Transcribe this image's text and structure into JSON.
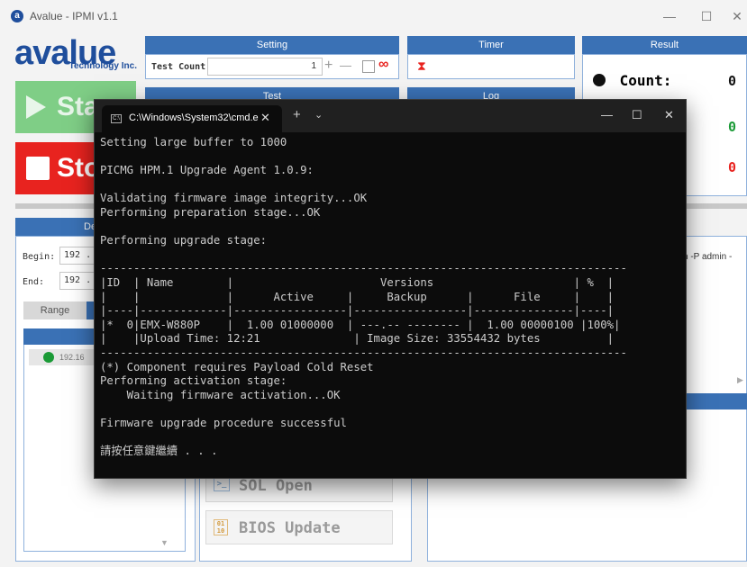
{
  "window": {
    "title": "Avalue - IPMI v1.1",
    "app_icon": "avalue-app-icon",
    "minimize": "—",
    "maximize": "☐",
    "close": "✕"
  },
  "logo": {
    "word": "avalue",
    "sub": "Technology Inc."
  },
  "buttons": {
    "start_label": "Sta",
    "stop_label": "Sto"
  },
  "setting": {
    "title": "Setting",
    "test_count_label": "Test Count",
    "test_count_value": "1",
    "plus": "+",
    "minus": "—",
    "infinity": "∞"
  },
  "timer": {
    "title": "Timer",
    "hourglass": "⧗"
  },
  "result": {
    "title": "Result",
    "count_label": "Count:",
    "count_value": "0",
    "row2_value": "0",
    "row3_value": "0"
  },
  "test": {
    "title": "Test"
  },
  "log": {
    "title": "Log"
  },
  "left": {
    "tab_de": "De",
    "begin_label": "Begin:",
    "begin_value": "192 .",
    "end_label": "End:",
    "end_value": "192 .",
    "range_tab": "Range",
    "list_item": "192.16"
  },
  "log_text": "n -P admin -",
  "test_buttons": {
    "sol_open": "SOL Open",
    "bios_update": "BIOS Update"
  },
  "cmd": {
    "tab_title": "C:\\Windows\\System32\\cmd.e",
    "tab_close": "✕",
    "new_tab": "+",
    "dropdown": "⌄",
    "minimize": "—",
    "maximize": "☐",
    "close": "✕",
    "lines": [
      "Setting large buffer to 1000",
      "",
      "PICMG HPM.1 Upgrade Agent 1.0.9:",
      "",
      "Validating firmware image integrity...OK",
      "Performing preparation stage...OK",
      "",
      "Performing upgrade stage:",
      "",
      "-------------------------------------------------------------------------------",
      "|ID  | Name        |                      Versions                     | %  |",
      "|    |             |      Active     |     Backup      |      File     |    |",
      "|----|-------------|-----------------|-----------------|---------------|----|",
      "|*  0|EMX-W880P    |  1.00 01000000  | ---.-- -------- |  1.00 00000100 |100%|",
      "|    |Upload Time: 12:21              | Image Size: 33554432 bytes          |",
      "-------------------------------------------------------------------------------",
      "(*) Component requires Payload Cold Reset",
      "Performing activation stage:",
      "    Waiting firmware activation...OK",
      "",
      "Firmware upgrade procedure successful",
      "",
      "請按任意鍵繼續 . . ."
    ]
  }
}
